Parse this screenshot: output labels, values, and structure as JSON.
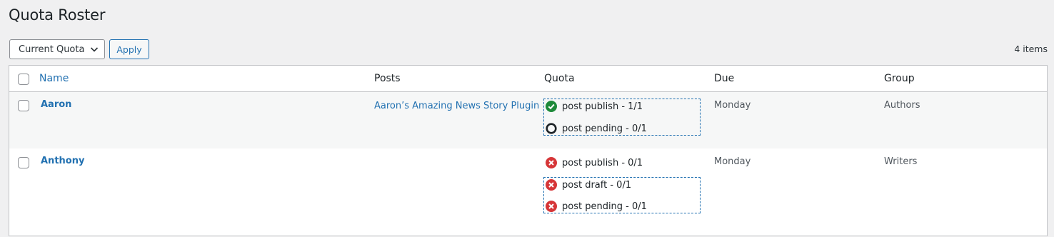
{
  "page": {
    "title": "Quota Roster"
  },
  "toolbar": {
    "filter_selected": "Current Quota",
    "apply_label": "Apply",
    "items_count": "4 items"
  },
  "table": {
    "columns": [
      "Name",
      "Posts",
      "Quota",
      "Due",
      "Group"
    ],
    "rows": [
      {
        "name": "Aaron",
        "post": "Aaron’s Amazing News Story Plugin",
        "quota": [
          {
            "status": "complete",
            "icon": "check-circle-icon",
            "text": "post publish - 1/1"
          },
          {
            "status": "pending",
            "icon": "empty-circle-icon",
            "text": "post pending - 0/1"
          }
        ],
        "due": "Monday",
        "group": "Authors"
      },
      {
        "name": "Anthony",
        "post": "",
        "quota": [
          {
            "status": "failed",
            "icon": "x-circle-icon",
            "text": "post publish - 0/1"
          },
          {
            "status": "failed",
            "icon": "x-circle-icon",
            "text": "post draft - 0/1"
          },
          {
            "status": "failed",
            "icon": "x-circle-icon",
            "text": "post pending - 0/1"
          }
        ],
        "due": "Monday",
        "group": "Writers"
      }
    ]
  },
  "colors": {
    "success": "#1e8a3a",
    "error": "#d63638",
    "pending": "#1d2327",
    "link": "#2271b1"
  }
}
